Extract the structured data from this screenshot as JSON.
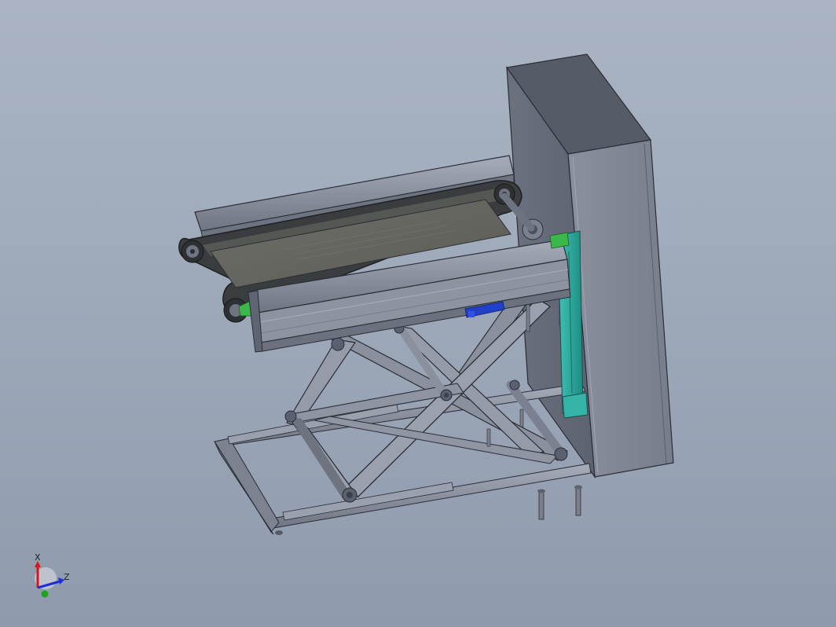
{
  "viewport": {
    "background_top": "#aab4c3",
    "background_bottom": "#8f9bac"
  },
  "triad": {
    "x_label": "X",
    "z_label": "Z",
    "x_color": "#d21a1a",
    "y_color": "#1ca21c",
    "z_color": "#1b2fd6"
  },
  "model": {
    "name_icon": "scissor-lift-conveyor-model",
    "cabinet_color": "#7e8595",
    "frame_color": "#8c93a3",
    "belt_color": "#3a3d3f",
    "cylinder_color": "#2ea79b",
    "accent_green": "#3cb84a",
    "accent_blue": "#2140c9"
  }
}
